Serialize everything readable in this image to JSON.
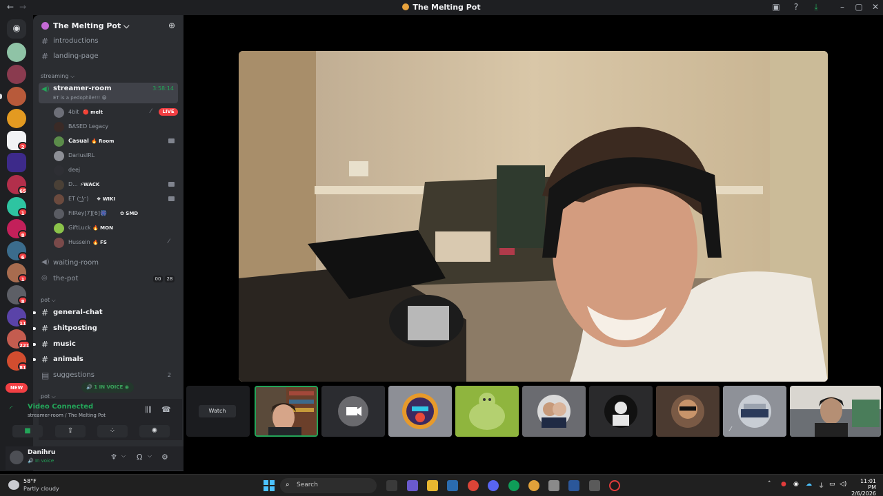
{
  "window": {
    "title": "The Melting Pot",
    "back": "←",
    "forward": "→"
  },
  "server": {
    "name": "The Melting Pot ⌵",
    "add_icon": "person-add-icon"
  },
  "rail": {
    "home_icon": "discord-icon",
    "new_badge": "NEW",
    "badges": [
      "2",
      "65",
      "1",
      "8",
      "6",
      "1",
      "8",
      "11",
      "221",
      "81",
      "2"
    ]
  },
  "channels": {
    "top": [
      "introductions",
      "landing-page"
    ],
    "streaming_category": "streaming ⌵",
    "voice_active": {
      "name": "streamer-room",
      "time": "3:58:14",
      "status": "ET is a pedophile!!! 😀"
    },
    "users": [
      {
        "name": "4bit",
        "tag": "🔴 melt",
        "live": "LIVE"
      },
      {
        "name": "BASED Legacy",
        "tag": ""
      },
      {
        "name": "Casual",
        "tag": "🔥 Room"
      },
      {
        "name": "DariusIRL",
        "tag": ""
      },
      {
        "name": "deej",
        "tag": ""
      },
      {
        "name": "D...",
        "tag": "⚡WACK"
      },
      {
        "name": "ET (ᵔ͜ʖᵔ)",
        "tag": "❖ WIKI"
      },
      {
        "name": "FilRey[7][6]🎆",
        "tag": "✿ SMD"
      },
      {
        "name": "GiftLuck",
        "tag": "🔥 MON"
      },
      {
        "name": "Hussein",
        "tag": "🔥 FS"
      }
    ],
    "waiting_room": "waiting-room",
    "the_pot": {
      "name": "the-pot",
      "count_a": "00",
      "count_b": "28"
    },
    "pot_category": "pot ⌵",
    "pot_channels": [
      "general-chat",
      "shitposting",
      "music",
      "animals",
      "suggestions"
    ],
    "suggestions_count": "2",
    "in_voice_pill": "🔊 1 IN VOICE ◉",
    "next_category": "pot ⌵"
  },
  "voice_panel": {
    "title": "Video Connected",
    "subtitle": "streamer-room / The Melting Pot"
  },
  "user": {
    "name": "Danihru",
    "status": "🔊 In voice"
  },
  "stage": {
    "watch_label": "Watch"
  },
  "taskbar": {
    "temp": "58°F",
    "condition": "Partly cloudy",
    "search_placeholder": "Search",
    "time": "11:01 PM",
    "date": "2/6/2026"
  },
  "colors": {
    "accent_green": "#23a559",
    "danger": "#f23f43",
    "sidebar": "#2b2d31",
    "rail": "#1e1f22"
  }
}
